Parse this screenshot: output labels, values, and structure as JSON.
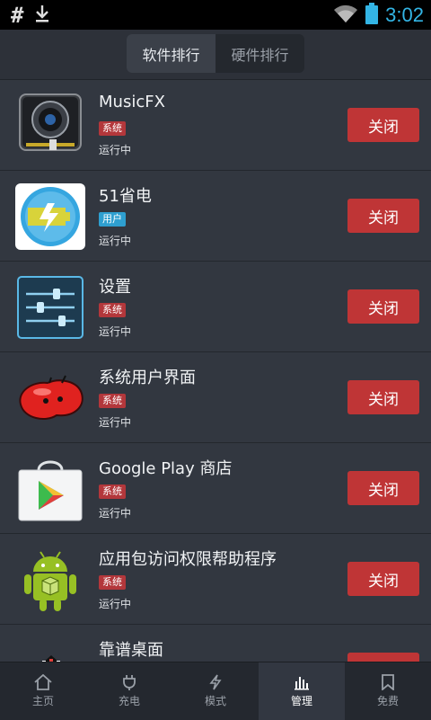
{
  "status_bar": {
    "time": "3:02",
    "left_icons": [
      "hash-icon",
      "download-icon"
    ],
    "right_icons": [
      "wifi-icon",
      "battery-icon"
    ]
  },
  "tabs": [
    {
      "label": "软件排行",
      "active": true
    },
    {
      "label": "硬件排行",
      "active": false
    }
  ],
  "apps": [
    {
      "name": "MusicFX",
      "badge": "系统",
      "badge_type": "system",
      "status": "运行中",
      "action": "关闭",
      "icon": "speaker-icon"
    },
    {
      "name": "51省电",
      "badge": "用户",
      "badge_type": "user",
      "status": "运行中",
      "action": "关闭",
      "icon": "battery-bolt-icon"
    },
    {
      "name": "设置",
      "badge": "系统",
      "badge_type": "system",
      "status": "运行中",
      "action": "关闭",
      "icon": "settings-sliders-icon"
    },
    {
      "name": "系统用户界面",
      "badge": "系统",
      "badge_type": "system",
      "status": "运行中",
      "action": "关闭",
      "icon": "jellybean-icon"
    },
    {
      "name": "Google Play 商店",
      "badge": "系统",
      "badge_type": "system",
      "status": "运行中",
      "action": "关闭",
      "icon": "play-store-bag-icon"
    },
    {
      "name": "应用包访问权限帮助程序",
      "badge": "系统",
      "badge_type": "system",
      "status": "运行中",
      "action": "关闭",
      "icon": "android-robot-icon"
    },
    {
      "name": "靠谱桌面",
      "badge": "",
      "badge_type": "",
      "status": "",
      "action": "",
      "icon": "launcher-icon"
    }
  ],
  "bottom_nav": [
    {
      "label": "主页",
      "icon": "home-icon",
      "active": false
    },
    {
      "label": "充电",
      "icon": "plug-icon",
      "active": false
    },
    {
      "label": "模式",
      "icon": "bolt-icon",
      "active": false
    },
    {
      "label": "管理",
      "icon": "bar-chart-icon",
      "active": true
    },
    {
      "label": "免费",
      "icon": "bookmark-icon",
      "active": false
    }
  ],
  "colors": {
    "close_button": "#bf3536",
    "system_badge": "#b3373b",
    "user_badge": "#2e9fd0",
    "clock": "#33b5e5"
  }
}
